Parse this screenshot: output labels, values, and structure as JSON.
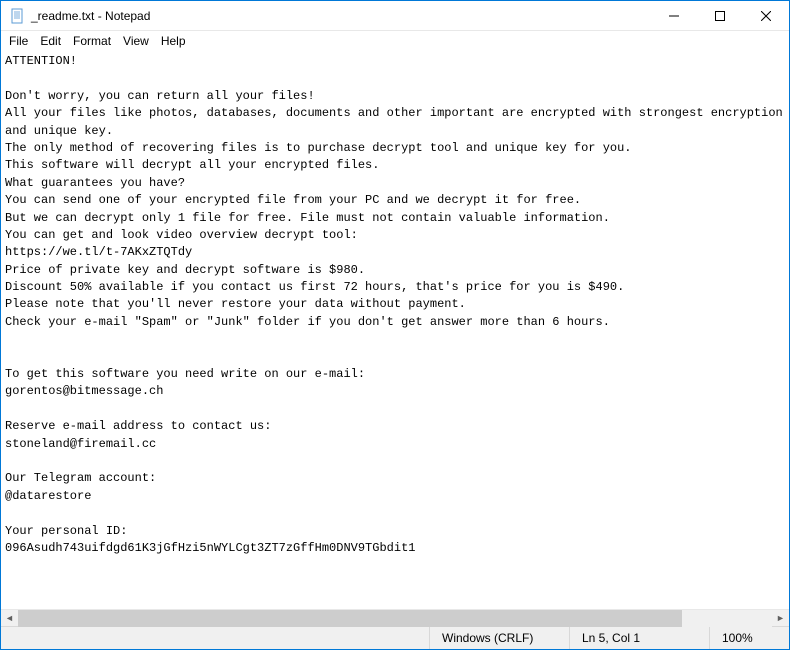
{
  "window": {
    "title": "_readme.txt - Notepad"
  },
  "menu": {
    "file": "File",
    "edit": "Edit",
    "format": "Format",
    "view": "View",
    "help": "Help"
  },
  "document": {
    "text": "ATTENTION!\n\nDon't worry, you can return all your files!\nAll your files like photos, databases, documents and other important are encrypted with strongest encryption and unique key.\nThe only method of recovering files is to purchase decrypt tool and unique key for you.\nThis software will decrypt all your encrypted files.\nWhat guarantees you have?\nYou can send one of your encrypted file from your PC and we decrypt it for free.\nBut we can decrypt only 1 file for free. File must not contain valuable information.\nYou can get and look video overview decrypt tool:\nhttps://we.tl/t-7AKxZTQTdy\nPrice of private key and decrypt software is $980.\nDiscount 50% available if you contact us first 72 hours, that's price for you is $490.\nPlease note that you'll never restore your data without payment.\nCheck your e-mail \"Spam\" or \"Junk\" folder if you don't get answer more than 6 hours.\n\n\nTo get this software you need write on our e-mail:\ngorentos@bitmessage.ch\n\nReserve e-mail address to contact us:\nstoneland@firemail.cc\n\nOur Telegram account:\n@datarestore\n\nYour personal ID:\n096Asudh743uifdgd61K3jGfHzi5nWYLCgt3ZT7zGffHm0DNV9TGbdit1"
  },
  "statusbar": {
    "encoding": "Windows (CRLF)",
    "position": "Ln 5, Col 1",
    "zoom": "100%"
  }
}
